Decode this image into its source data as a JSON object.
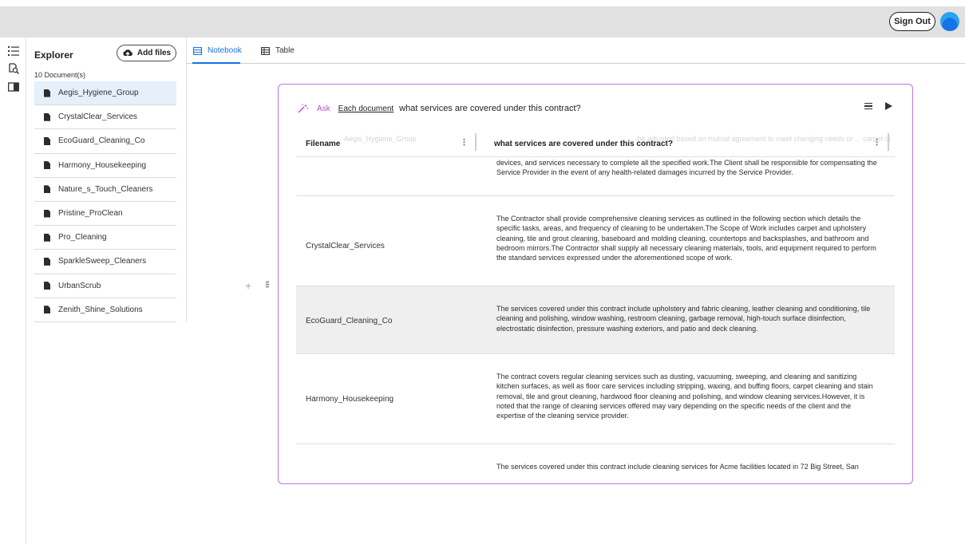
{
  "header": {
    "signout_label": "Sign Out"
  },
  "rail": {
    "icons": [
      "list-icon",
      "search-doc-icon",
      "panel-icon"
    ]
  },
  "explorer": {
    "title": "Explorer",
    "add_files_label": "Add files",
    "doc_count": "10 Document(s)",
    "documents": [
      "Aegis_Hygiene_Group",
      "CrystalClear_Services",
      "EcoGuard_Cleaning_Co",
      "Harmony_Housekeeping",
      "Nature_s_Touch_Cleaners",
      "Pristine_ProClean",
      "Pro_Cleaning",
      "SparkleSweep_Cleaners",
      "UrbanScrub",
      "Zenith_Shine_Solutions"
    ],
    "selected_index": 0
  },
  "tabs": [
    {
      "label": "Notebook",
      "icon": "notebook-icon",
      "active": true
    },
    {
      "label": "Table",
      "icon": "table-icon",
      "active": false
    }
  ],
  "cell": {
    "ask_label": "Ask",
    "scope_label": "Each document",
    "question": "what services are covered under this contract?",
    "columns": [
      "Filename",
      "what services are covered under this contract?"
    ],
    "ghost_row": {
      "filename": "Aegis_Hygiene_Group",
      "answer": "...be adjusted based on mutual agreement to meet changing needs or ... carpet cleaning, floor treatments, equipment, appliances, fixtures,"
    },
    "rows": [
      {
        "filename": "",
        "answer": "devices, and services necessary to complete all the specified work.The Client shall be responsible for compensating the Service Provider in the event of any health-related damages incurred by the Service Provider."
      },
      {
        "filename": "CrystalClear_Services",
        "answer": "The Contractor shall provide comprehensive cleaning services as outlined in the following section which details the specific tasks, areas, and frequency of cleaning to be undertaken.The Scope of Work includes carpet and upholstery cleaning, tile and grout cleaning, baseboard and molding cleaning, countertops and backsplashes, and bathroom and bedroom mirrors.The Contractor shall supply all necessary cleaning materials, tools, and equipment required to perform the standard services expressed under the aforementioned scope of work."
      },
      {
        "filename": "EcoGuard_Cleaning_Co",
        "answer": "The services covered under this contract include upholstery and fabric cleaning, leather cleaning and conditioning, tile cleaning and polishing, window washing, restroom cleaning, garbage removal, high-touch surface disinfection, electrostatic disinfection, pressure washing exteriors, and patio and deck cleaning."
      },
      {
        "filename": "Harmony_Housekeeping",
        "answer": "The contract covers regular cleaning services such as dusting, vacuuming, sweeping, and cleaning and sanitizing kitchen surfaces, as well as floor care services including stripping, waxing, and buffing floors, carpet cleaning and stain removal, tile and grout cleaning, hardwood floor cleaning and polishing, and window cleaning services.However, it is noted that the range of cleaning services offered may vary depending on the specific needs of the client and the expertise of the cleaning service provider."
      },
      {
        "filename": "",
        "answer": "The services covered under this contract include cleaning services for Acme facilities located in 72 Big Street, San"
      }
    ]
  }
}
